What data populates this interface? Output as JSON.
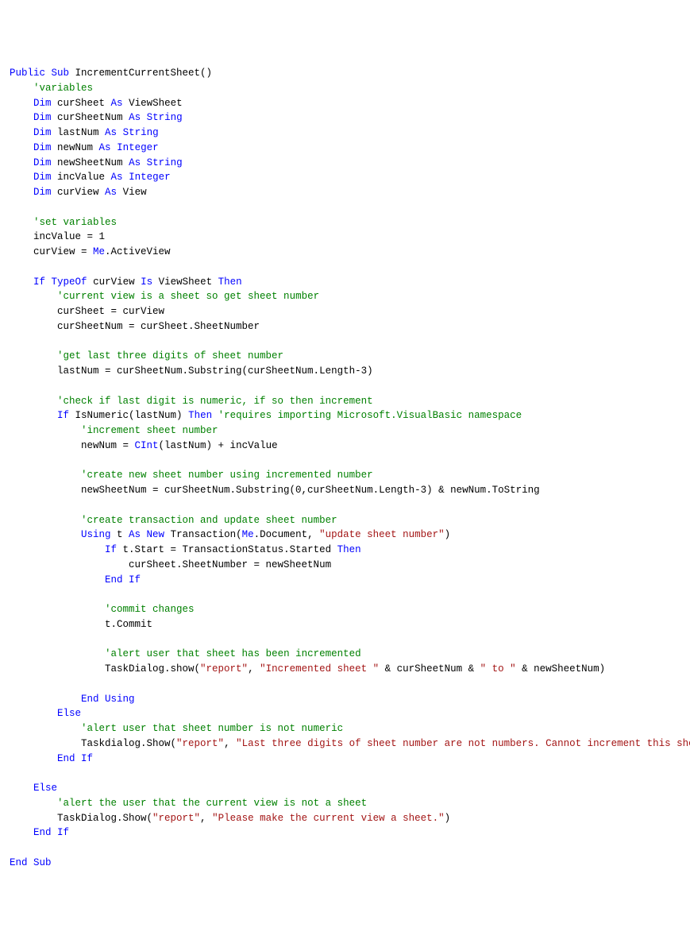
{
  "code": {
    "lines": [
      [
        [
          "kw",
          "Public Sub"
        ],
        [
          "",
          " IncrementCurrentSheet()"
        ]
      ],
      [
        [
          "",
          "    "
        ],
        [
          "cm",
          "'variables"
        ]
      ],
      [
        [
          "",
          "    "
        ],
        [
          "kw",
          "Dim"
        ],
        [
          "",
          " curSheet "
        ],
        [
          "kw",
          "As"
        ],
        [
          "",
          " ViewSheet"
        ]
      ],
      [
        [
          "",
          "    "
        ],
        [
          "kw",
          "Dim"
        ],
        [
          "",
          " curSheetNum "
        ],
        [
          "kw",
          "As"
        ],
        [
          "",
          " "
        ],
        [
          "kw",
          "String"
        ]
      ],
      [
        [
          "",
          "    "
        ],
        [
          "kw",
          "Dim"
        ],
        [
          "",
          " lastNum "
        ],
        [
          "kw",
          "As"
        ],
        [
          "",
          " "
        ],
        [
          "kw",
          "String"
        ]
      ],
      [
        [
          "",
          "    "
        ],
        [
          "kw",
          "Dim"
        ],
        [
          "",
          " newNum "
        ],
        [
          "kw",
          "As"
        ],
        [
          "",
          " "
        ],
        [
          "kw",
          "Integer"
        ]
      ],
      [
        [
          "",
          "    "
        ],
        [
          "kw",
          "Dim"
        ],
        [
          "",
          " newSheetNum "
        ],
        [
          "kw",
          "As"
        ],
        [
          "",
          " "
        ],
        [
          "kw",
          "String"
        ]
      ],
      [
        [
          "",
          "    "
        ],
        [
          "kw",
          "Dim"
        ],
        [
          "",
          " incValue "
        ],
        [
          "kw",
          "As"
        ],
        [
          "",
          " "
        ],
        [
          "kw",
          "Integer"
        ]
      ],
      [
        [
          "",
          "    "
        ],
        [
          "kw",
          "Dim"
        ],
        [
          "",
          " curView "
        ],
        [
          "kw",
          "As"
        ],
        [
          "",
          " View"
        ]
      ],
      [
        [
          "",
          ""
        ]
      ],
      [
        [
          "",
          "    "
        ],
        [
          "cm",
          "'set variables"
        ]
      ],
      [
        [
          "",
          "    incValue = 1"
        ]
      ],
      [
        [
          "",
          "    curView = "
        ],
        [
          "kw",
          "Me"
        ],
        [
          "",
          ".ActiveView"
        ]
      ],
      [
        [
          "",
          ""
        ]
      ],
      [
        [
          "",
          "    "
        ],
        [
          "kw",
          "If"
        ],
        [
          "",
          " "
        ],
        [
          "kw",
          "TypeOf"
        ],
        [
          "",
          " curView "
        ],
        [
          "kw",
          "Is"
        ],
        [
          "",
          " ViewSheet "
        ],
        [
          "kw",
          "Then"
        ]
      ],
      [
        [
          "",
          "        "
        ],
        [
          "cm",
          "'current view is a sheet so get sheet number"
        ]
      ],
      [
        [
          "",
          "        curSheet = curView"
        ]
      ],
      [
        [
          "",
          "        curSheetNum = curSheet.SheetNumber"
        ]
      ],
      [
        [
          "",
          ""
        ]
      ],
      [
        [
          "",
          "        "
        ],
        [
          "cm",
          "'get last three digits of sheet number"
        ]
      ],
      [
        [
          "",
          "        lastNum = curSheetNum.Substring(curSheetNum.Length-3)"
        ]
      ],
      [
        [
          "",
          ""
        ]
      ],
      [
        [
          "",
          "        "
        ],
        [
          "cm",
          "'check if last digit is numeric, if so then increment"
        ]
      ],
      [
        [
          "",
          "        "
        ],
        [
          "kw",
          "If"
        ],
        [
          "",
          " IsNumeric(lastNum) "
        ],
        [
          "kw",
          "Then"
        ],
        [
          "",
          " "
        ],
        [
          "cm",
          "'requires importing Microsoft.VisualBasic namespace"
        ]
      ],
      [
        [
          "",
          "            "
        ],
        [
          "cm",
          "'increment sheet number"
        ]
      ],
      [
        [
          "",
          "            newNum = "
        ],
        [
          "kw",
          "CInt"
        ],
        [
          "",
          "(lastNum) + incValue"
        ]
      ],
      [
        [
          "",
          ""
        ]
      ],
      [
        [
          "",
          "            "
        ],
        [
          "cm",
          "'create new sheet number using incremented number"
        ]
      ],
      [
        [
          "",
          "            newSheetNum = curSheetNum.Substring(0,curSheetNum.Length-3) & newNum.ToString"
        ]
      ],
      [
        [
          "",
          ""
        ]
      ],
      [
        [
          "",
          "            "
        ],
        [
          "cm",
          "'create transaction and update sheet number"
        ]
      ],
      [
        [
          "",
          "            "
        ],
        [
          "kw",
          "Using"
        ],
        [
          "",
          " t "
        ],
        [
          "kw",
          "As New"
        ],
        [
          "",
          " Transaction("
        ],
        [
          "kw",
          "Me"
        ],
        [
          "",
          ".Document, "
        ],
        [
          "str",
          "\"update sheet number\""
        ],
        [
          "",
          ")"
        ]
      ],
      [
        [
          "",
          "                "
        ],
        [
          "kw",
          "If"
        ],
        [
          "",
          " t.Start = TransactionStatus.Started "
        ],
        [
          "kw",
          "Then"
        ]
      ],
      [
        [
          "",
          "                    curSheet.SheetNumber = newSheetNum"
        ]
      ],
      [
        [
          "",
          "                "
        ],
        [
          "kw",
          "End If"
        ]
      ],
      [
        [
          "",
          ""
        ]
      ],
      [
        [
          "",
          "                "
        ],
        [
          "cm",
          "'commit changes"
        ]
      ],
      [
        [
          "",
          "                t.Commit"
        ]
      ],
      [
        [
          "",
          ""
        ]
      ],
      [
        [
          "",
          "                "
        ],
        [
          "cm",
          "'alert user that sheet has been incremented"
        ]
      ],
      [
        [
          "",
          "                TaskDialog.show("
        ],
        [
          "str",
          "\"report\""
        ],
        [
          "",
          ", "
        ],
        [
          "str",
          "\"Incremented sheet \""
        ],
        [
          "",
          " & curSheetNum & "
        ],
        [
          "str",
          "\" to \""
        ],
        [
          "",
          " & newSheetNum)"
        ]
      ],
      [
        [
          "",
          ""
        ]
      ],
      [
        [
          "",
          "            "
        ],
        [
          "kw",
          "End Using"
        ]
      ],
      [
        [
          "",
          "        "
        ],
        [
          "kw",
          "Else"
        ]
      ],
      [
        [
          "",
          "            "
        ],
        [
          "cm",
          "'alert user that sheet number is not numeric"
        ]
      ],
      [
        [
          "",
          "            Taskdialog.Show("
        ],
        [
          "str",
          "\"report\""
        ],
        [
          "",
          ", "
        ],
        [
          "str",
          "\"Last three digits of sheet number are not numbers. Cannot increment this sheet.\""
        ],
        [
          "",
          ")"
        ]
      ],
      [
        [
          "",
          "        "
        ],
        [
          "kw",
          "End If"
        ]
      ],
      [
        [
          "",
          ""
        ]
      ],
      [
        [
          "",
          "    "
        ],
        [
          "kw",
          "Else"
        ]
      ],
      [
        [
          "",
          "        "
        ],
        [
          "cm",
          "'alert the user that the current view is not a sheet"
        ]
      ],
      [
        [
          "",
          "        TaskDialog.Show("
        ],
        [
          "str",
          "\"report\""
        ],
        [
          "",
          ", "
        ],
        [
          "str",
          "\"Please make the current view a sheet.\""
        ],
        [
          "",
          ")"
        ]
      ],
      [
        [
          "",
          "    "
        ],
        [
          "kw",
          "End If"
        ]
      ],
      [
        [
          "",
          ""
        ]
      ],
      [
        [
          "kw",
          "End Sub"
        ]
      ]
    ]
  }
}
